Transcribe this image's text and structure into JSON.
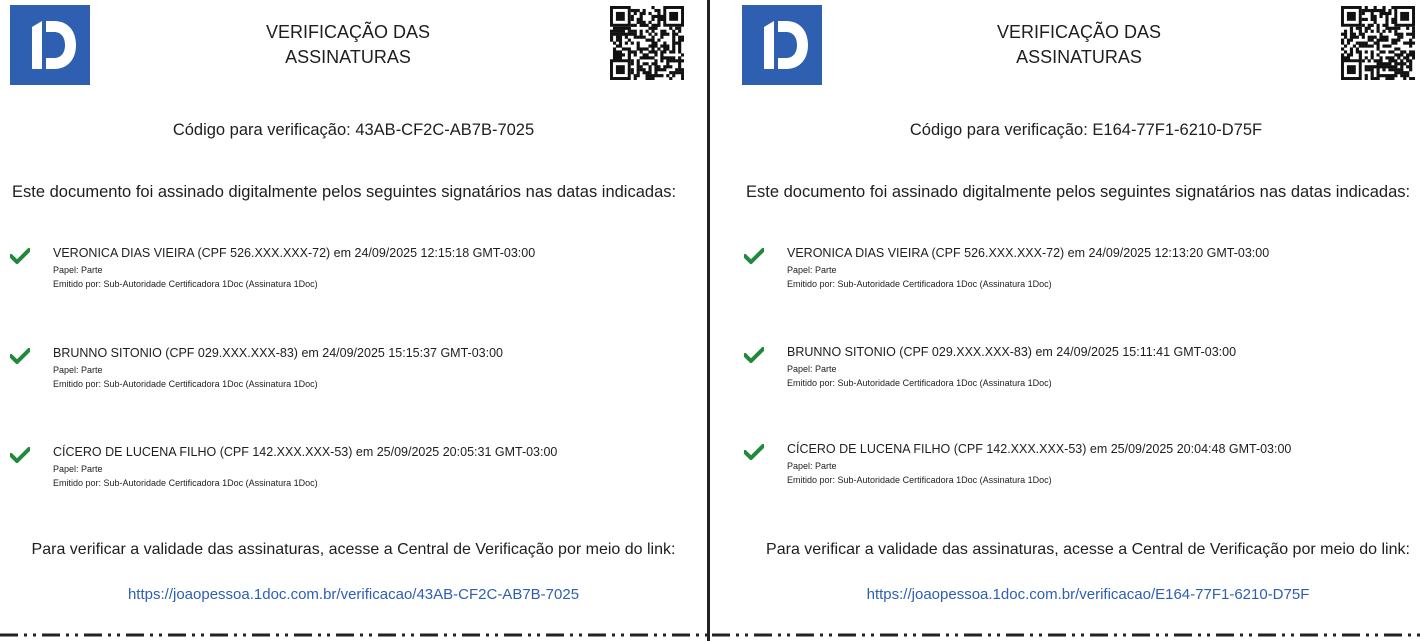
{
  "pages": [
    {
      "title_line1": "VERIFICAÇÃO DAS",
      "title_line2": "ASSINATURAS",
      "code_line": "Código para verificação: 43AB-CF2C-AB7B-7025",
      "intro": "Este documento foi assinado digitalmente pelos seguintes signatários nas datas indicadas:",
      "signers": [
        {
          "main": "VERONICA DIAS VIEIRA (CPF 526.XXX.XXX-72) em 24/09/2025 12:15:18 GMT-03:00",
          "role": "Papel: Parte",
          "issuer": "Emitido por: Sub-Autoridade Certificadora 1Doc (Assinatura 1Doc)"
        },
        {
          "main": "BRUNNO SITONIO (CPF 029.XXX.XXX-83) em 24/09/2025 15:15:37 GMT-03:00",
          "role": "Papel: Parte",
          "issuer": "Emitido por: Sub-Autoridade Certificadora 1Doc (Assinatura 1Doc)"
        },
        {
          "main": "CÍCERO DE LUCENA FILHO (CPF 142.XXX.XXX-53) em 25/09/2025 20:05:31 GMT-03:00",
          "role": "Papel: Parte",
          "issuer": "Emitido por: Sub-Autoridade Certificadora 1Doc (Assinatura 1Doc)"
        }
      ],
      "verify_text": "Para verificar a validade das assinaturas, acesse a Central de Verificação por meio do link:",
      "verify_link": "https://joaopessoa.1doc.com.br/verificacao/43AB-CF2C-AB7B-7025"
    },
    {
      "title_line1": "VERIFICAÇÃO DAS",
      "title_line2": "ASSINATURAS",
      "code_line": "Código para verificação: E164-77F1-6210-D75F",
      "intro": "Este documento foi assinado digitalmente pelos seguintes signatários nas datas indicadas:",
      "signers": [
        {
          "main": "VERONICA DIAS VIEIRA (CPF 526.XXX.XXX-72) em 24/09/2025 12:13:20 GMT-03:00",
          "role": "Papel: Parte",
          "issuer": "Emitido por: Sub-Autoridade Certificadora 1Doc (Assinatura 1Doc)"
        },
        {
          "main": "BRUNNO SITONIO (CPF 029.XXX.XXX-83) em 24/09/2025 15:11:41 GMT-03:00",
          "role": "Papel: Parte",
          "issuer": "Emitido por: Sub-Autoridade Certificadora 1Doc (Assinatura 1Doc)"
        },
        {
          "main": "CÍCERO DE LUCENA FILHO (CPF 142.XXX.XXX-53) em 25/09/2025 20:04:48 GMT-03:00",
          "role": "Papel: Parte",
          "issuer": "Emitido por: Sub-Autoridade Certificadora 1Doc (Assinatura 1Doc)"
        }
      ],
      "verify_text": "Para verificar a validade das assinaturas, acesse a Central de Verificação por meio do link:",
      "verify_link": "https://joaopessoa.1doc.com.br/verificacao/E164-77F1-6210-D75F"
    }
  ],
  "icons": {
    "logo": "1doc-logo",
    "qr": "qr-code-icon",
    "check": "check-icon"
  },
  "colors": {
    "brand": "#2e5fb0",
    "check": "#1f8a3a",
    "link": "#2e5fb0",
    "text": "#1e1e1e"
  }
}
